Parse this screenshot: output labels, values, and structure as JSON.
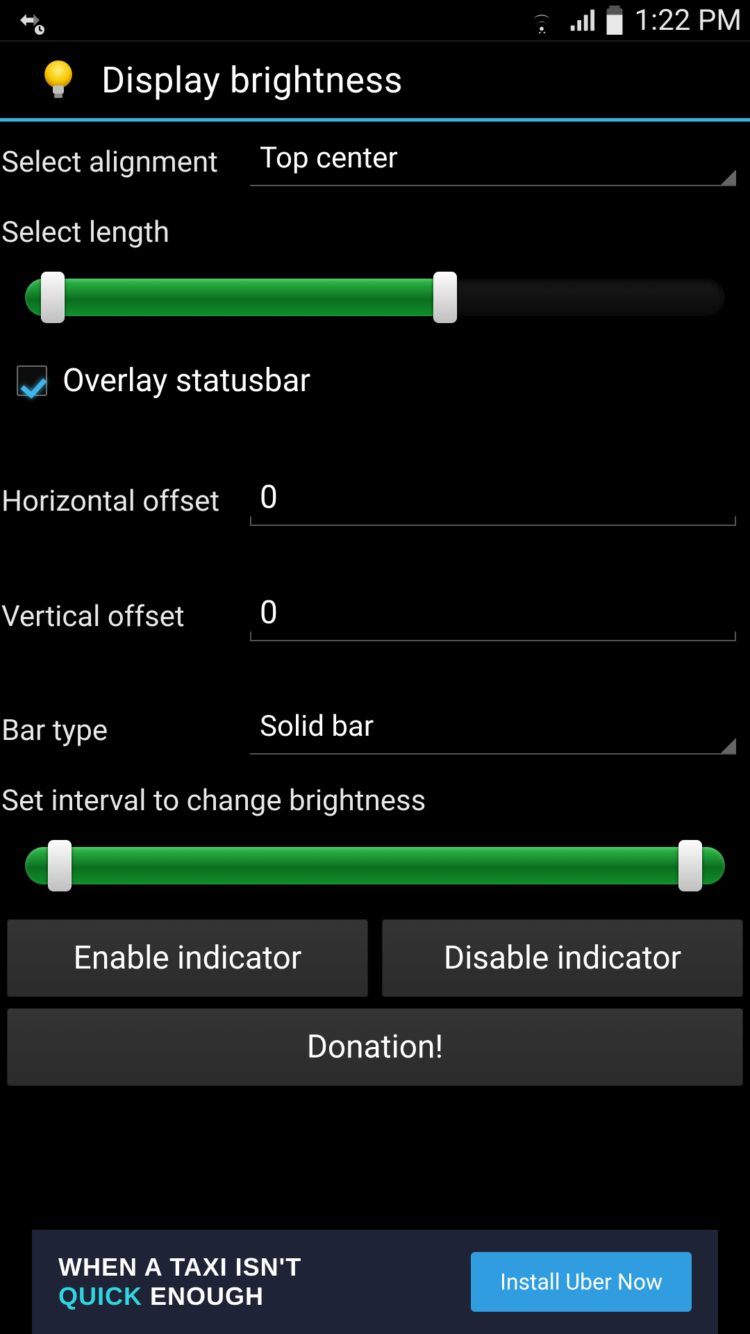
{
  "status": {
    "time": "1:22 PM"
  },
  "header": {
    "title": "Display brightness"
  },
  "alignment": {
    "label": "Select alignment",
    "value": "Top center"
  },
  "length": {
    "label": "Select length",
    "low_pct": 4,
    "high_pct": 60
  },
  "overlay": {
    "label": "Overlay statusbar",
    "checked": true
  },
  "hoffset": {
    "label": "Horizontal offset",
    "value": "0"
  },
  "voffset": {
    "label": "Vertical offset",
    "value": "0"
  },
  "bartype": {
    "label": "Bar type",
    "value": "Solid bar"
  },
  "interval": {
    "label": "Set interval to change brightness",
    "low_pct": 5,
    "high_pct": 95
  },
  "buttons": {
    "enable": "Enable indicator",
    "disable": "Disable indicator",
    "donate": "Donation!"
  },
  "ad": {
    "line1": "WHEN A TAXI ISN'T",
    "quick": "QUICK",
    "enough": " ENOUGH",
    "cta": "Install Uber Now"
  }
}
